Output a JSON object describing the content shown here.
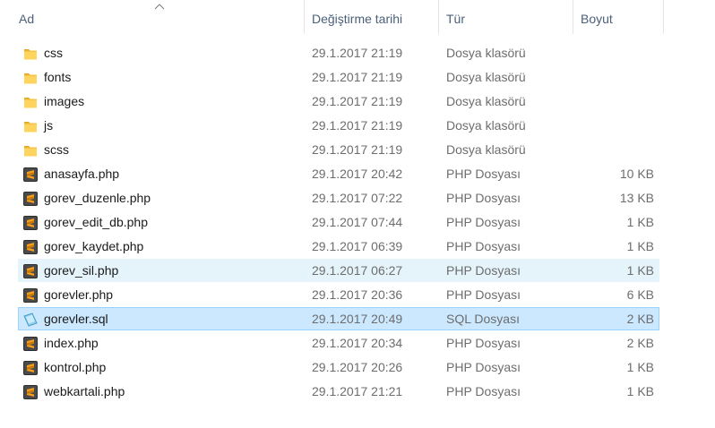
{
  "columns": {
    "name": "Ad",
    "date": "Değiştirme tarihi",
    "type": "Tür",
    "size": "Boyut"
  },
  "sort": {
    "column": "name",
    "direction": "ascending",
    "icon": "sort-up-arrow-icon"
  },
  "files": [
    {
      "name": "css",
      "date": "29.1.2017 21:19",
      "type": "Dosya klasörü",
      "size": "",
      "icon": "folder-icon",
      "state": ""
    },
    {
      "name": "fonts",
      "date": "29.1.2017 21:19",
      "type": "Dosya klasörü",
      "size": "",
      "icon": "folder-icon",
      "state": ""
    },
    {
      "name": "images",
      "date": "29.1.2017 21:19",
      "type": "Dosya klasörü",
      "size": "",
      "icon": "folder-icon",
      "state": ""
    },
    {
      "name": "js",
      "date": "29.1.2017 21:19",
      "type": "Dosya klasörü",
      "size": "",
      "icon": "folder-icon",
      "state": ""
    },
    {
      "name": "scss",
      "date": "29.1.2017 21:19",
      "type": "Dosya klasörü",
      "size": "",
      "icon": "folder-icon",
      "state": ""
    },
    {
      "name": "anasayfa.php",
      "date": "29.1.2017 20:42",
      "type": "PHP Dosyası",
      "size": "10 KB",
      "icon": "sublime-file-icon",
      "state": ""
    },
    {
      "name": "gorev_duzenle.php",
      "date": "29.1.2017 07:22",
      "type": "PHP Dosyası",
      "size": "13 KB",
      "icon": "sublime-file-icon",
      "state": ""
    },
    {
      "name": "gorev_edit_db.php",
      "date": "29.1.2017 07:44",
      "type": "PHP Dosyası",
      "size": "1 KB",
      "icon": "sublime-file-icon",
      "state": ""
    },
    {
      "name": "gorev_kaydet.php",
      "date": "29.1.2017 06:39",
      "type": "PHP Dosyası",
      "size": "1 KB",
      "icon": "sublime-file-icon",
      "state": ""
    },
    {
      "name": "gorev_sil.php",
      "date": "29.1.2017 06:27",
      "type": "PHP Dosyası",
      "size": "1 KB",
      "icon": "sublime-file-icon",
      "state": "hover"
    },
    {
      "name": "gorevler.php",
      "date": "29.1.2017 20:36",
      "type": "PHP Dosyası",
      "size": "6 KB",
      "icon": "sublime-file-icon",
      "state": ""
    },
    {
      "name": "gorevler.sql",
      "date": "29.1.2017 20:49",
      "type": "SQL Dosyası",
      "size": "2 KB",
      "icon": "sql-file-icon",
      "state": "selected"
    },
    {
      "name": "index.php",
      "date": "29.1.2017 20:34",
      "type": "PHP Dosyası",
      "size": "2 KB",
      "icon": "sublime-file-icon",
      "state": ""
    },
    {
      "name": "kontrol.php",
      "date": "29.1.2017 20:26",
      "type": "PHP Dosyası",
      "size": "1 KB",
      "icon": "sublime-file-icon",
      "state": ""
    },
    {
      "name": "webkartali.php",
      "date": "29.1.2017 21:21",
      "type": "PHP Dosyası",
      "size": "1 KB",
      "icon": "sublime-file-icon",
      "state": ""
    }
  ],
  "colors": {
    "hover_bg": "#e5f3fb",
    "selected_bg": "#cce8ff",
    "selected_border": "#99d1ff",
    "header_text": "#4c607a",
    "folder": "#f6c343"
  }
}
